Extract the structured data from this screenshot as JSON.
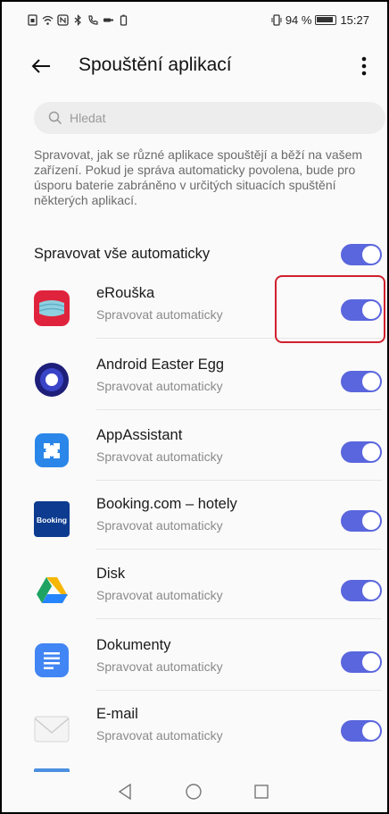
{
  "status_bar": {
    "battery_percent": "94 %",
    "time": "15:27"
  },
  "header": {
    "title": "Spouštění aplikací"
  },
  "search": {
    "placeholder": "Hledat"
  },
  "description": "Spravovat, jak se různé aplikace spouštějí a běží na vašem zařízení. Pokud je správa automaticky povolena, bude pro úsporu baterie zabráněno v určitých situacích spuštění některých aplikací.",
  "manage_all": {
    "label": "Spravovat vše automaticky",
    "enabled": true
  },
  "apps": [
    {
      "name": "eRouška",
      "status": "Spravovat automaticky",
      "enabled": true,
      "icon": "erouska-icon"
    },
    {
      "name": "Android Easter Egg",
      "status": "Spravovat automaticky",
      "enabled": true,
      "icon": "android-easter-egg-icon"
    },
    {
      "name": "AppAssistant",
      "status": "Spravovat automaticky",
      "enabled": true,
      "icon": "appassistant-icon"
    },
    {
      "name": "Booking.com – hotely",
      "status": "Spravovat automaticky",
      "enabled": true,
      "icon": "booking-icon",
      "icon_text": "Booking"
    },
    {
      "name": "Disk",
      "status": "Spravovat automaticky",
      "enabled": true,
      "icon": "google-drive-icon"
    },
    {
      "name": "Dokumenty",
      "status": "Spravovat automaticky",
      "enabled": true,
      "icon": "docs-icon"
    },
    {
      "name": "E-mail",
      "status": "Spravovat automaticky",
      "enabled": true,
      "icon": "email-icon"
    }
  ],
  "colors": {
    "toggle_on": "#5a66dd",
    "highlight": "#d0202e"
  }
}
